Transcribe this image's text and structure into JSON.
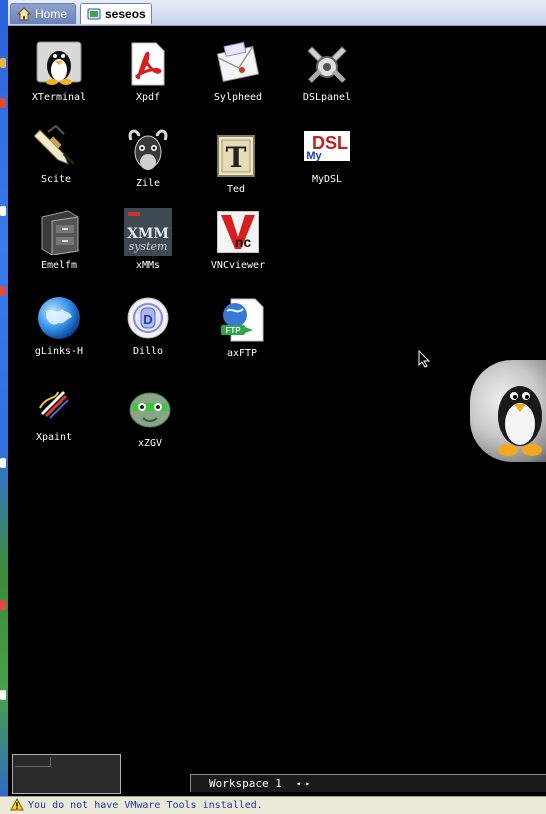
{
  "tabs": [
    {
      "label": "Home",
      "icon": "home-icon",
      "active": false
    },
    {
      "label": "seseos",
      "icon": "vm-icon",
      "active": true
    }
  ],
  "desktop_icons": [
    {
      "label": "XTerminal",
      "icon": "tux-terminal-icon"
    },
    {
      "label": "Xpdf",
      "icon": "pdf-icon"
    },
    {
      "label": "Sylpheed",
      "icon": "mail-icon"
    },
    {
      "label": "DSLpanel",
      "icon": "tools-icon"
    },
    {
      "label": "Scite",
      "icon": "pen-icon"
    },
    {
      "label": "Zile",
      "icon": "gnu-icon"
    },
    {
      "label": "Ted",
      "icon": "ted-icon"
    },
    {
      "label": "MyDSL",
      "icon": "mydsl-icon"
    },
    {
      "label": "Emelfm",
      "icon": "cabinet-icon"
    },
    {
      "label": "xMMs",
      "icon": "xmms-icon"
    },
    {
      "label": "VNCviewer",
      "icon": "vnc-icon"
    },
    {
      "label": "gLinks-H",
      "icon": "globe-icon"
    },
    {
      "label": "Dillo",
      "icon": "dillo-icon"
    },
    {
      "label": "axFTP",
      "icon": "ftp-icon"
    },
    {
      "label": "Xpaint",
      "icon": "paint-icon"
    },
    {
      "label": "xZGV",
      "icon": "xzgv-icon"
    }
  ],
  "workspace": {
    "label": "Workspace 1",
    "arrows": "◂ ▸"
  },
  "status": {
    "message": "You do not have VMware Tools installed."
  },
  "colors": {
    "tab_bar": "#c6d3ea",
    "desktop": "#000000",
    "status_bg": "#ece9d8",
    "status_text": "#1c3aa8"
  }
}
